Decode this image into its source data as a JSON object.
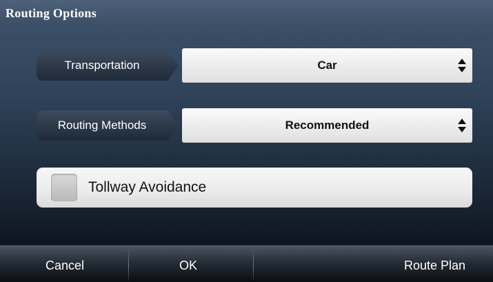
{
  "dialog": {
    "title": "Routing Options"
  },
  "transportation": {
    "label": "Transportation",
    "value": "Car",
    "icon": "up-down-arrows-icon"
  },
  "routing_methods": {
    "label": "Routing Methods",
    "value": "Recommended",
    "icon": "up-down-arrows-icon"
  },
  "tollway_avoidance": {
    "label": "Tollway Avoidance",
    "checked": false
  },
  "bottom_bar": {
    "cancel_label": "Cancel",
    "ok_label": "OK",
    "route_plan_label": "Route Plan"
  },
  "colors": {
    "background": "#2f4258",
    "label_background": "#2b3848",
    "select_background": "#efefef",
    "text_dark": "#111111",
    "text_light": "#ffffff"
  }
}
